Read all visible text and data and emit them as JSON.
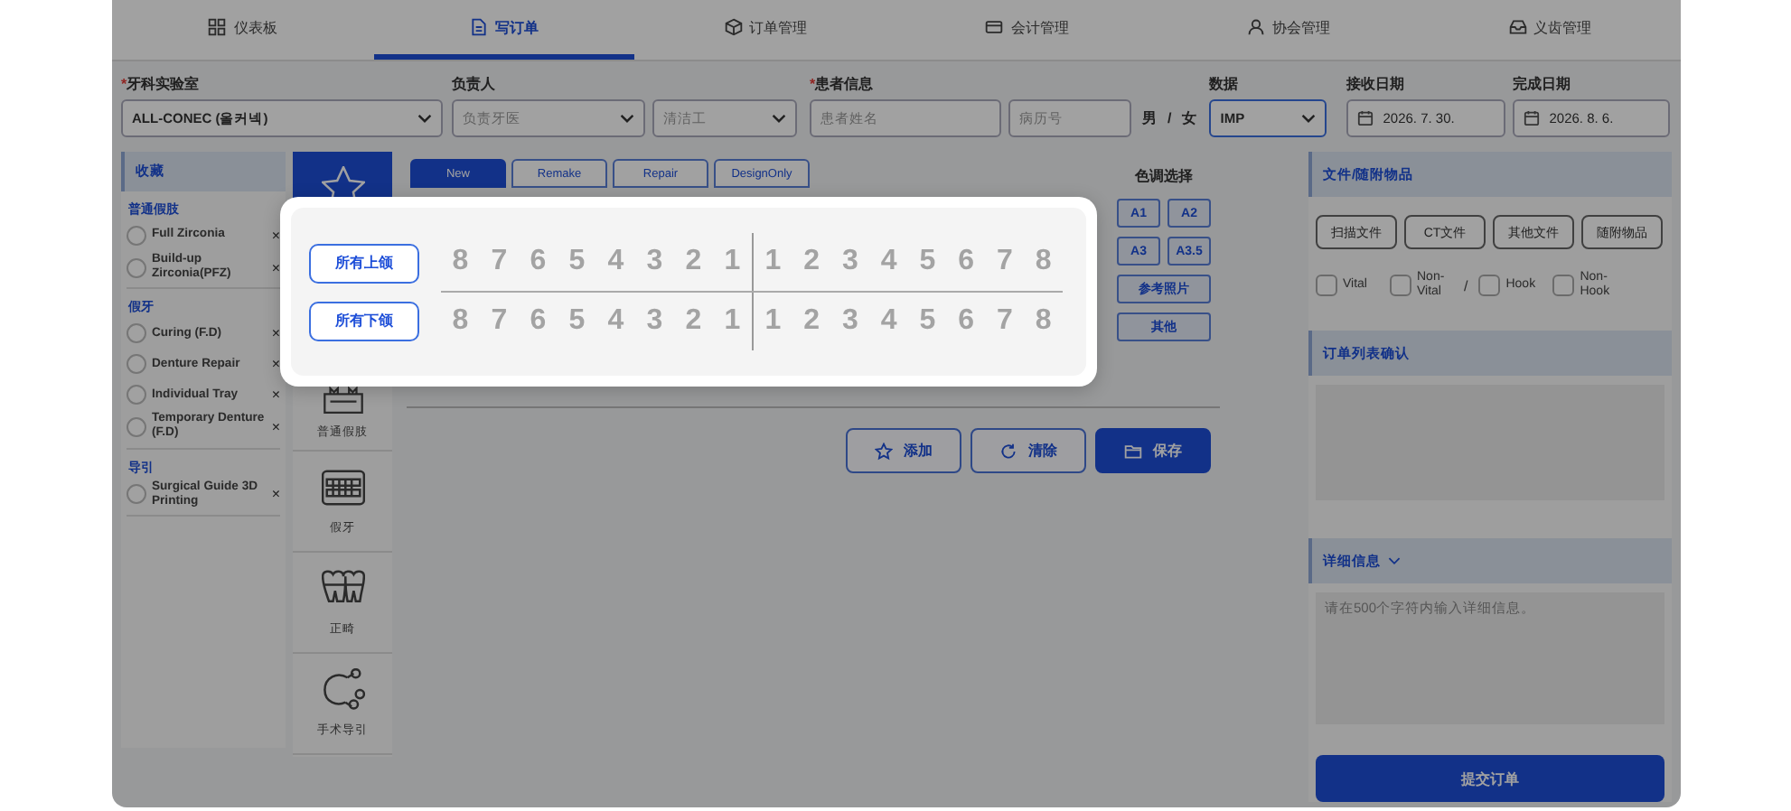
{
  "tabs": [
    {
      "label": "仪表板",
      "selected": false
    },
    {
      "label": "写订单",
      "selected": true
    },
    {
      "label": "订单管理",
      "selected": false
    },
    {
      "label": "会计管理",
      "selected": false
    },
    {
      "label": "协会管理",
      "selected": false
    },
    {
      "label": "义齿管理",
      "selected": false
    }
  ],
  "form": {
    "lab": {
      "mark": "*",
      "label": "牙科实验室",
      "value": "ALL-CONEC (올커넥)"
    },
    "staff": {
      "label": "负责人",
      "dentist_placeholder": "负责牙医",
      "cleaner_placeholder": "清洁工"
    },
    "patient": {
      "mark": "*",
      "label": "患者信息",
      "name_placeholder": "患者姓名",
      "chart_placeholder": "病历号",
      "male": "男",
      "separator": "/",
      "female": "女"
    },
    "data": {
      "label": "数据",
      "value": "IMP"
    },
    "received": {
      "label": "接收日期",
      "value": "2026. 7. 30."
    },
    "completed": {
      "label": "完成日期",
      "value": "2026. 8. 6."
    }
  },
  "favorites": {
    "title": "收藏",
    "groups": [
      {
        "label": "普通假肢",
        "items": [
          {
            "label": "Full Zirconia",
            "checked": false,
            "remove": "×"
          },
          {
            "label": "Build-up Zirconia(PFZ)",
            "checked": false,
            "remove": "×"
          }
        ]
      },
      {
        "label": "假牙",
        "items": [
          {
            "label": "Curing (F.D)",
            "checked": false,
            "remove": "×"
          },
          {
            "label": "Denture Repair",
            "checked": false,
            "remove": "×"
          },
          {
            "label": "Individual Tray",
            "checked": false,
            "remove": "×"
          },
          {
            "label": "Temporary Denture (F.D)",
            "checked": false,
            "remove": "×"
          }
        ]
      },
      {
        "label": "导引",
        "items": [
          {
            "label": "Surgical Guide 3D Printing",
            "checked": false,
            "remove": "×"
          }
        ]
      }
    ]
  },
  "categories": [
    {
      "selected": true
    },
    {
      "label": "普通假肢",
      "selected": false
    },
    {
      "label": "假牙",
      "selected": false
    },
    {
      "label": "正畸",
      "selected": false
    },
    {
      "label": "手术导引",
      "selected": false
    }
  ],
  "order_types": [
    {
      "label": "New",
      "selected": true
    },
    {
      "label": "Remake",
      "selected": false
    },
    {
      "label": "Repair",
      "selected": false
    },
    {
      "label": "DesignOnly",
      "selected": false
    }
  ],
  "shade": {
    "title": "色调选择",
    "options": [
      "A1",
      "A2",
      "A3",
      "A3.5",
      "参考照片",
      "其他"
    ]
  },
  "actions": [
    {
      "label": "添加",
      "primary": false
    },
    {
      "label": "清除",
      "primary": false
    },
    {
      "label": "保存",
      "primary": true
    }
  ],
  "files": {
    "title": "文件/随附物品",
    "buttons": [
      "扫描文件",
      "CT文件",
      "其他文件",
      "随附物品"
    ],
    "checks": [
      {
        "label": "Vital",
        "checked": false
      },
      {
        "label": "Non-Vital",
        "checked": false
      },
      {
        "label": "Hook",
        "checked": false
      },
      {
        "label": "Non-Hook",
        "checked": false
      }
    ],
    "separator": "/"
  },
  "order_list": {
    "title": "订单列表确认"
  },
  "details": {
    "title": "详细信息",
    "placeholder": "请在500个字符内输入详细信息。"
  },
  "submit": "提交订单",
  "tooth_popup": {
    "upper_button": "所有上颌",
    "lower_button": "所有下颌",
    "upper": [
      {
        "n": "8",
        "selected": false
      },
      {
        "n": "7",
        "selected": false
      },
      {
        "n": "6",
        "selected": false
      },
      {
        "n": "5",
        "selected": false
      },
      {
        "n": "4",
        "selected": false
      },
      {
        "n": "3",
        "selected": false
      },
      {
        "n": "2",
        "selected": false
      },
      {
        "n": "1",
        "selected": false
      },
      {
        "n": "1",
        "selected": false
      },
      {
        "n": "2",
        "selected": false
      },
      {
        "n": "3",
        "selected": false
      },
      {
        "n": "4",
        "selected": false
      },
      {
        "n": "5",
        "selected": false
      },
      {
        "n": "6",
        "selected": false
      },
      {
        "n": "7",
        "selected": false
      },
      {
        "n": "8",
        "selected": false
      }
    ],
    "lower": [
      {
        "n": "8",
        "selected": false
      },
      {
        "n": "7",
        "selected": false
      },
      {
        "n": "6",
        "selected": false
      },
      {
        "n": "5",
        "selected": false
      },
      {
        "n": "4",
        "selected": false
      },
      {
        "n": "3",
        "selected": false
      },
      {
        "n": "2",
        "selected": false
      },
      {
        "n": "1",
        "selected": false
      },
      {
        "n": "1",
        "selected": false
      },
      {
        "n": "2",
        "selected": false
      },
      {
        "n": "3",
        "selected": false
      },
      {
        "n": "4",
        "selected": false
      },
      {
        "n": "5",
        "selected": false
      },
      {
        "n": "6",
        "selected": false
      },
      {
        "n": "7",
        "selected": false
      },
      {
        "n": "8",
        "selected": false
      }
    ]
  }
}
